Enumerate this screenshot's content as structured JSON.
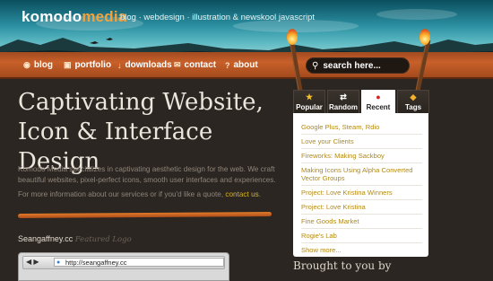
{
  "header": {
    "logo_part1": "komodo",
    "logo_part2": "media",
    "tagline": "blog · webdesign · illustration & newskool javascript"
  },
  "nav": {
    "items": [
      {
        "label": "blog",
        "icon": "rss-icon"
      },
      {
        "label": "portfolio",
        "icon": "folder-icon"
      },
      {
        "label": "downloads",
        "icon": "download-icon"
      },
      {
        "label": "contact",
        "icon": "mail-icon"
      },
      {
        "label": "about",
        "icon": "question-icon"
      }
    ],
    "search_placeholder": "search here..."
  },
  "main": {
    "headline_line1": "Captivating Website,",
    "headline_line2": "Icon & Interface Design",
    "intro": "Komodo Media specializes in captivating aesthetic design for the web. We craft beautiful websites, pixel-perfect icons, smooth user interfaces and experiences.",
    "more_text": "For more information about our services or if you'd like a quote,",
    "more_link": "contact us",
    "more_end": ".",
    "featured_site": "Seangaffney.cc",
    "featured_label": "Featured Logo",
    "browser_url": "http://seangaffney.cc",
    "browser_back": "◀ ▶"
  },
  "sidebar": {
    "tabs": [
      {
        "label": "Popular",
        "icon": "star-icon"
      },
      {
        "label": "Random",
        "icon": "shuffle-icon"
      },
      {
        "label": "Recent",
        "icon": "clock-icon"
      },
      {
        "label": "Tags",
        "icon": "tag-icon"
      }
    ],
    "active_tab": "Recent",
    "recent_posts": [
      "Google Plus, Steam, Rdio",
      "Love your Clients",
      "Fireworks: Making Sackboy",
      "Making Icons Using Alpha Converted Vector Groups",
      "Project: Love Kristina Winners",
      "Project: Love Kristina",
      "Fine Goods Market",
      "Rogie's Lab",
      "Show more..."
    ],
    "brought_to_you_by": "Brought to you by"
  },
  "colors": {
    "accent_orange": "#c8602a",
    "link_gold": "#d2b22a",
    "background": "#2b2621"
  }
}
